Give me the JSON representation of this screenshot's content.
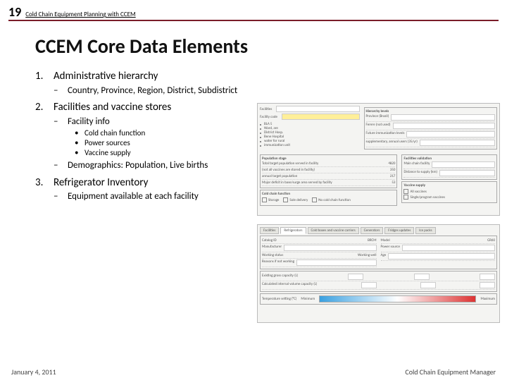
{
  "header": {
    "page_number": "19",
    "subtitle": "Cold Chain Equipment Planning with CCEM"
  },
  "title": "CCEM Core Data Elements",
  "outline": {
    "item1": {
      "num": "1.",
      "label": "Administrative hierarchy",
      "sub1": {
        "dash": "–",
        "label": "Country, Province, Region, District, Subdistrict"
      }
    },
    "item2": {
      "num": "2.",
      "label": "Facilities and vaccine stores",
      "sub1": {
        "dash": "–",
        "label": "Facility info",
        "b1": {
          "dot": "•",
          "label": "Cold chain function"
        },
        "b2": {
          "dot": "•",
          "label": "Power sources"
        },
        "b3": {
          "dot": "•",
          "label": "Vaccine supply"
        }
      },
      "sub2": {
        "dash": "–",
        "label": "Demographics: Population, Live births"
      }
    },
    "item3": {
      "num": "3.",
      "label": "Refrigerator Inventory",
      "sub1": {
        "dash": "–",
        "label": "Equipment available at each facility"
      }
    }
  },
  "screenshot1": {
    "facility_label": "Facilities",
    "facility_code_label": "Facility code",
    "rows": {
      "r1": "BLA 5",
      "r2": "Ward, are",
      "r3": "District Hosp.",
      "r4": "Bene Hospital",
      "r5": "water for rural",
      "r6": "immunization unit"
    },
    "right_header": "Hierarchy levels",
    "right_rows": {
      "r1": "Province (Brazil)",
      "r2": "Ferere (not used)",
      "r3": "Future immunization levels",
      "r4": "supplementary, annual users (35/yr)"
    },
    "stats_header": "Population stage",
    "stats": {
      "s1l": "Total target population served in facility",
      "s1v": "4820",
      "s2l": "(not all vaccines are stored in facility)",
      "s2v": "350",
      "s3l": "annual target population",
      "s3v": "217",
      "s4l": "Major deficit in base/surge area served by facility",
      "s4v": "53"
    },
    "cold_chain_label": "Cold chain function",
    "chk1": "Storage",
    "chk2": "Sole delivery",
    "chk3": "No cold chain function",
    "panel_header": "Facilities validation",
    "panel_l1": "Main chain facility",
    "panel_l2": "Distance to supply (km)",
    "vs_label": "Vaccine supply",
    "vs_chk1": "All vaccines",
    "vs_chk2": "Single/program vaccines"
  },
  "screenshot2": {
    "tabs": {
      "t1": "Facilities",
      "t2": "Refrigerators",
      "t3": "Cold boxes and vaccine carriers",
      "t4": "Generators",
      "t5": "Fridges updates",
      "t6": "Ice packs"
    },
    "left": {
      "l1l": "Catalog ID",
      "l1v": "BRCM",
      "l2l": "Manufacturer",
      "l3l": "Working status",
      "l3v": "Working well",
      "l4l": "Reasons if not working"
    },
    "right": {
      "r1l": "Model",
      "r1v": "GR60",
      "r2l": "Power source",
      "r3l": "Age"
    },
    "row1l": "Existing gross capacity (L)",
    "row2l": "Calculated internal volume capacity (L)",
    "bar": {
      "label": "Temperature setting (°C)",
      "min": "Minimum",
      "max": "Maximum"
    }
  },
  "footer": {
    "date": "January 4, 2011",
    "right": "Cold Chain Equipment Manager"
  }
}
